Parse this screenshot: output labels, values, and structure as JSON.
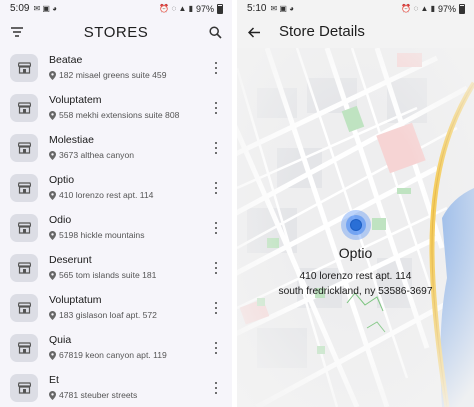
{
  "left_phone": {
    "status": {
      "time": "5:09",
      "battery": "97%"
    },
    "title": "STORES",
    "stores": [
      {
        "name": "Beatae",
        "address": "182 misael greens suite 459"
      },
      {
        "name": "Voluptatem",
        "address": "558 mekhi extensions suite 808"
      },
      {
        "name": "Molestiae",
        "address": "3673 althea canyon"
      },
      {
        "name": "Optio",
        "address": "410 lorenzo rest apt. 114"
      },
      {
        "name": "Odio",
        "address": "5198 hickle mountains"
      },
      {
        "name": "Deserunt",
        "address": "565 tom islands suite 181"
      },
      {
        "name": "Voluptatum",
        "address": "183 gislason loaf apt. 572"
      },
      {
        "name": "Quia",
        "address": "67819 keon canyon apt. 119"
      },
      {
        "name": "Et",
        "address": "4781 steuber streets"
      }
    ],
    "icons": {
      "filter": "filter-icon",
      "search": "search-icon",
      "store": "store-icon",
      "location": "location-pin-icon",
      "more": "more-vert-icon"
    }
  },
  "right_phone": {
    "status": {
      "time": "5:10",
      "battery": "97%"
    },
    "title": "Store Details",
    "store": {
      "name": "Optio",
      "address_line1": "410 lorenzo rest apt. 114",
      "address_line2": "south fredrickland, ny 53586-3697"
    },
    "icons": {
      "back": "back-arrow-icon",
      "marker": "location-marker-icon"
    }
  },
  "colors": {
    "accent": "#2a6fd6",
    "list_bg": "#f6f5fa",
    "avatar_bg": "#dcdde5",
    "map_park": "#bfe3c1",
    "map_highway": "#f5c84a",
    "map_water": "#8fb4e8"
  }
}
